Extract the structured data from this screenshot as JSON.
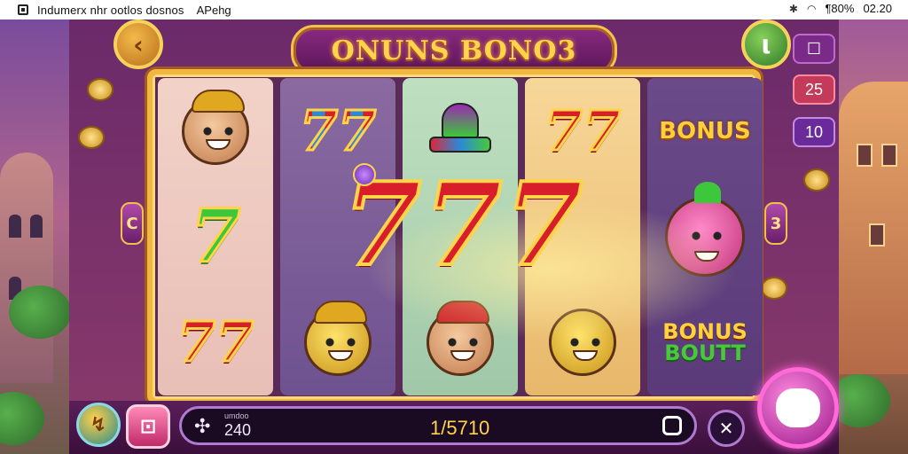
{
  "status_bar": {
    "app_title": "Indumerx nhr ootlos dosnos",
    "account": "APehg",
    "battery": "¶80%",
    "time": "02.20"
  },
  "game": {
    "marquee_title": "ONUNS BONO3",
    "side_left_label": "C",
    "side_right_label": "3",
    "side_badges": [
      "25",
      "10"
    ]
  },
  "reels": [
    {
      "symbols": [
        "tan-face",
        "seven-green",
        "seven-multi"
      ]
    },
    {
      "symbols": [
        "seven-multi",
        "seven-red-big",
        "gold-hat-face"
      ]
    },
    {
      "symbols": [
        "wild-hat",
        "seven-red-big",
        "pirate-face"
      ]
    },
    {
      "symbols": [
        "seven-red",
        "seven-red-big",
        "gold-cat-face"
      ]
    },
    {
      "symbols": [
        "bonus",
        "pink-cat-face",
        "bonus-bout"
      ]
    }
  ],
  "symbols_text": {
    "seven": "7",
    "bonus": "BONUS",
    "bonus_bout_l1": "BONUS",
    "bonus_bout_l2": "BOUTT"
  },
  "bottom_bar": {
    "bet_label": "umdoo",
    "bet_value": "240",
    "win_value": "1/5710"
  },
  "colors": {
    "frame_gold": "#f0b840",
    "accent_purple": "#7a2a88",
    "spin_pink": "#ff6ad8"
  },
  "icons": {
    "back": "chevron-left-icon",
    "info": "info-icon",
    "menu": "menu-icon",
    "autoplay": "autoplay-icon",
    "paytable": "paytable-icon",
    "lines": "lines-icon",
    "stop": "stop-icon",
    "turbo": "turbo-icon",
    "spin": "spin-icon"
  }
}
